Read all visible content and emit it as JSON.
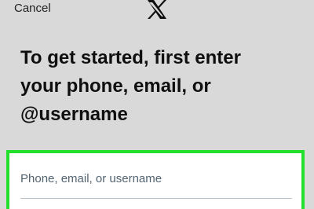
{
  "header": {
    "cancel_label": "Cancel",
    "logo_icon": "x-logo-icon"
  },
  "main": {
    "headline": "To get started, first enter\nyour phone, email, or\n@username",
    "login_field": {
      "placeholder": "Phone, email, or username",
      "value": ""
    }
  },
  "colors": {
    "background": "#d9d9d9",
    "highlight": "#22e02c",
    "text": "#0f0f0f"
  }
}
